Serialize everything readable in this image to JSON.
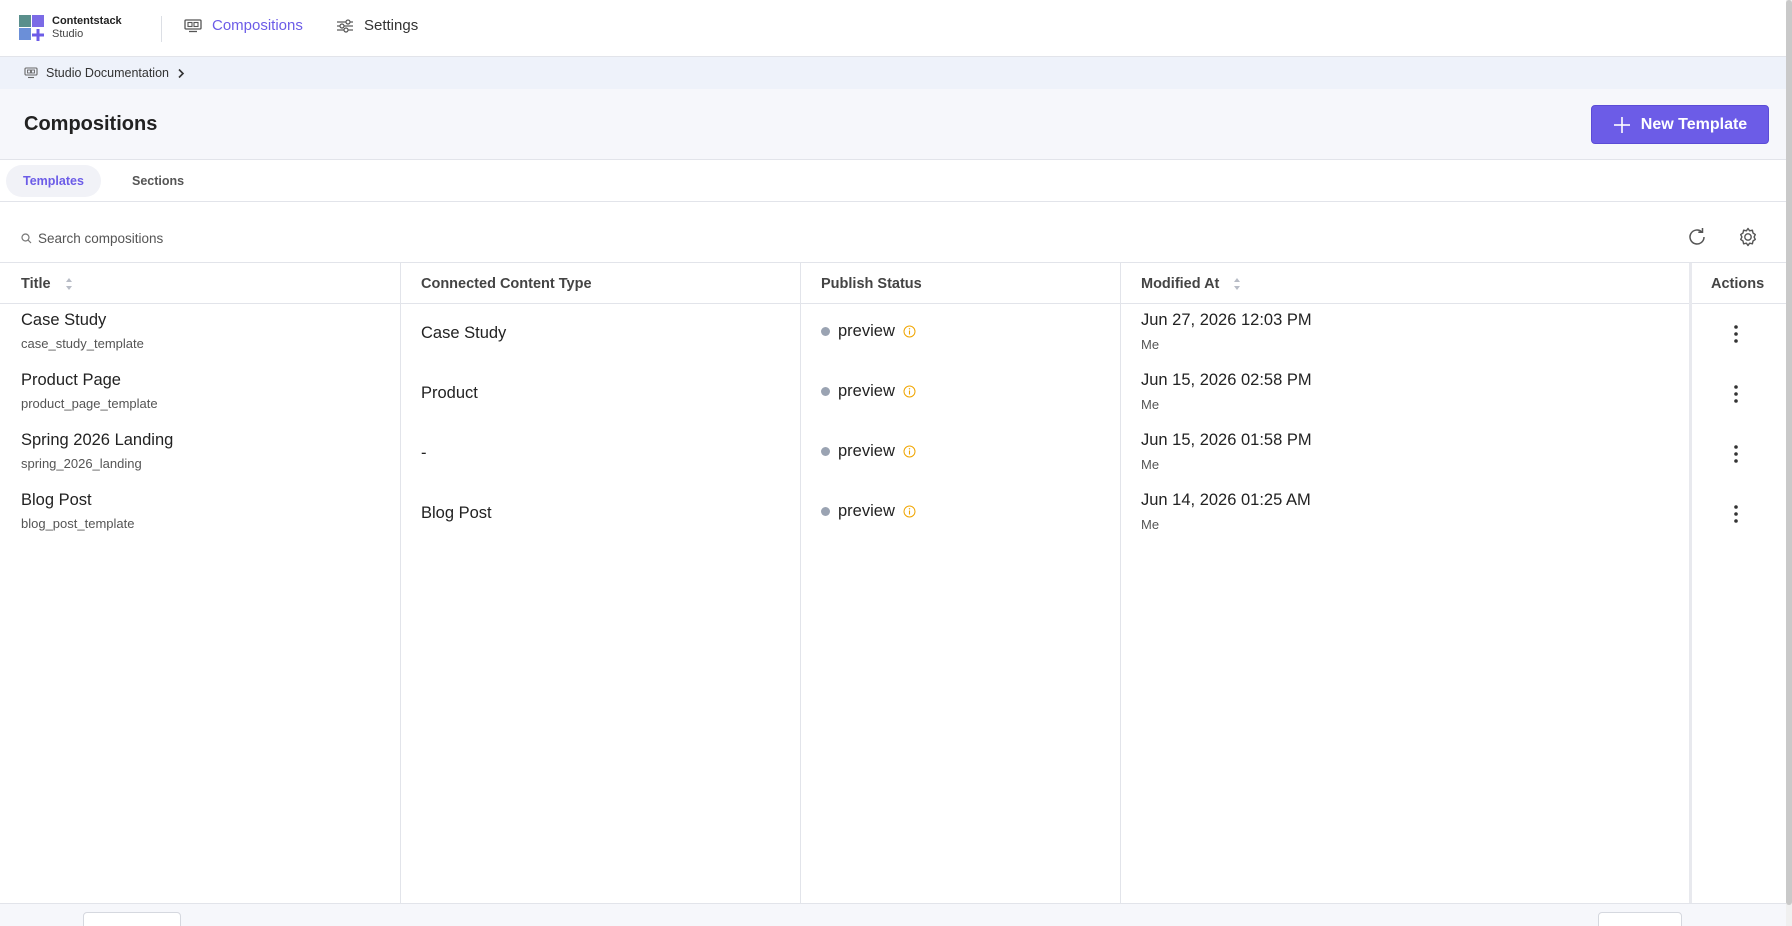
{
  "app": {
    "brand_line1": "Contentstack",
    "brand_line2": "Studio"
  },
  "nav": {
    "compositions": "Compositions",
    "settings": "Settings"
  },
  "breadcrumb": {
    "item": "Studio Documentation"
  },
  "header": {
    "title": "Compositions",
    "new_button": "New Template"
  },
  "tabs": [
    {
      "label": "Templates",
      "active": true
    },
    {
      "label": "Sections",
      "active": false
    }
  ],
  "search": {
    "placeholder": "Search compositions",
    "value": ""
  },
  "table": {
    "columns": [
      "Title",
      "Connected Content Type",
      "Publish Status",
      "Modified At",
      "Actions"
    ],
    "rows": [
      {
        "title": "Case Study",
        "uid": "case_study_template",
        "content_type": "Case Study",
        "status": "preview",
        "modified": "Jun 27, 2026 12:03 PM",
        "by": "Me"
      },
      {
        "title": "Product Page",
        "uid": "product_page_template",
        "content_type": "Product",
        "status": "preview",
        "modified": "Jun 15, 2026 02:58 PM",
        "by": "Me"
      },
      {
        "title": "Spring 2026 Landing",
        "uid": "spring_2026_landing",
        "content_type": "-",
        "status": "preview",
        "modified": "Jun 15, 2026 01:58 PM",
        "by": "Me"
      },
      {
        "title": "Blog Post",
        "uid": "blog_post_template",
        "content_type": "Blog Post",
        "status": "preview",
        "modified": "Jun 14, 2026 01:25 AM",
        "by": "Me"
      }
    ]
  },
  "colors": {
    "accent": "#6c5ce7",
    "status_dot": "#9aa3b2",
    "info": "#f0a500"
  }
}
